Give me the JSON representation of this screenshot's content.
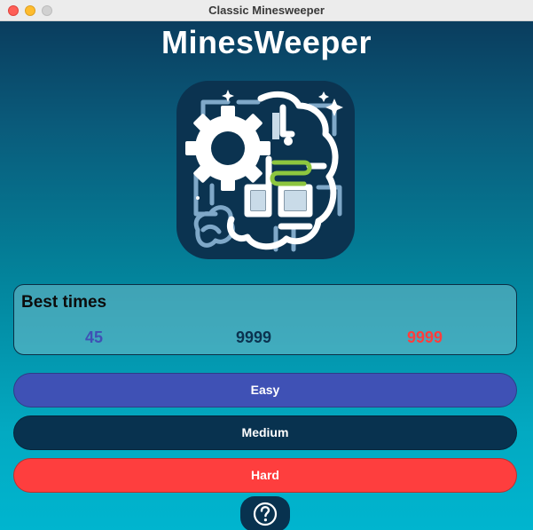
{
  "window": {
    "title": "Classic Minesweeper"
  },
  "app": {
    "title": "MinesWeeper",
    "logo_icon": "brain-gear-circuit-icon"
  },
  "best_times": {
    "heading": "Best times",
    "easy": "45",
    "medium": "9999",
    "hard": "9999"
  },
  "buttons": {
    "easy": "Easy",
    "medium": "Medium",
    "hard": "Hard",
    "help_icon": "question-mark-icon"
  },
  "colors": {
    "easy": "#3f51b5",
    "medium": "#08324f",
    "hard": "#fe3e3e",
    "accent_green": "#8dc63f"
  }
}
